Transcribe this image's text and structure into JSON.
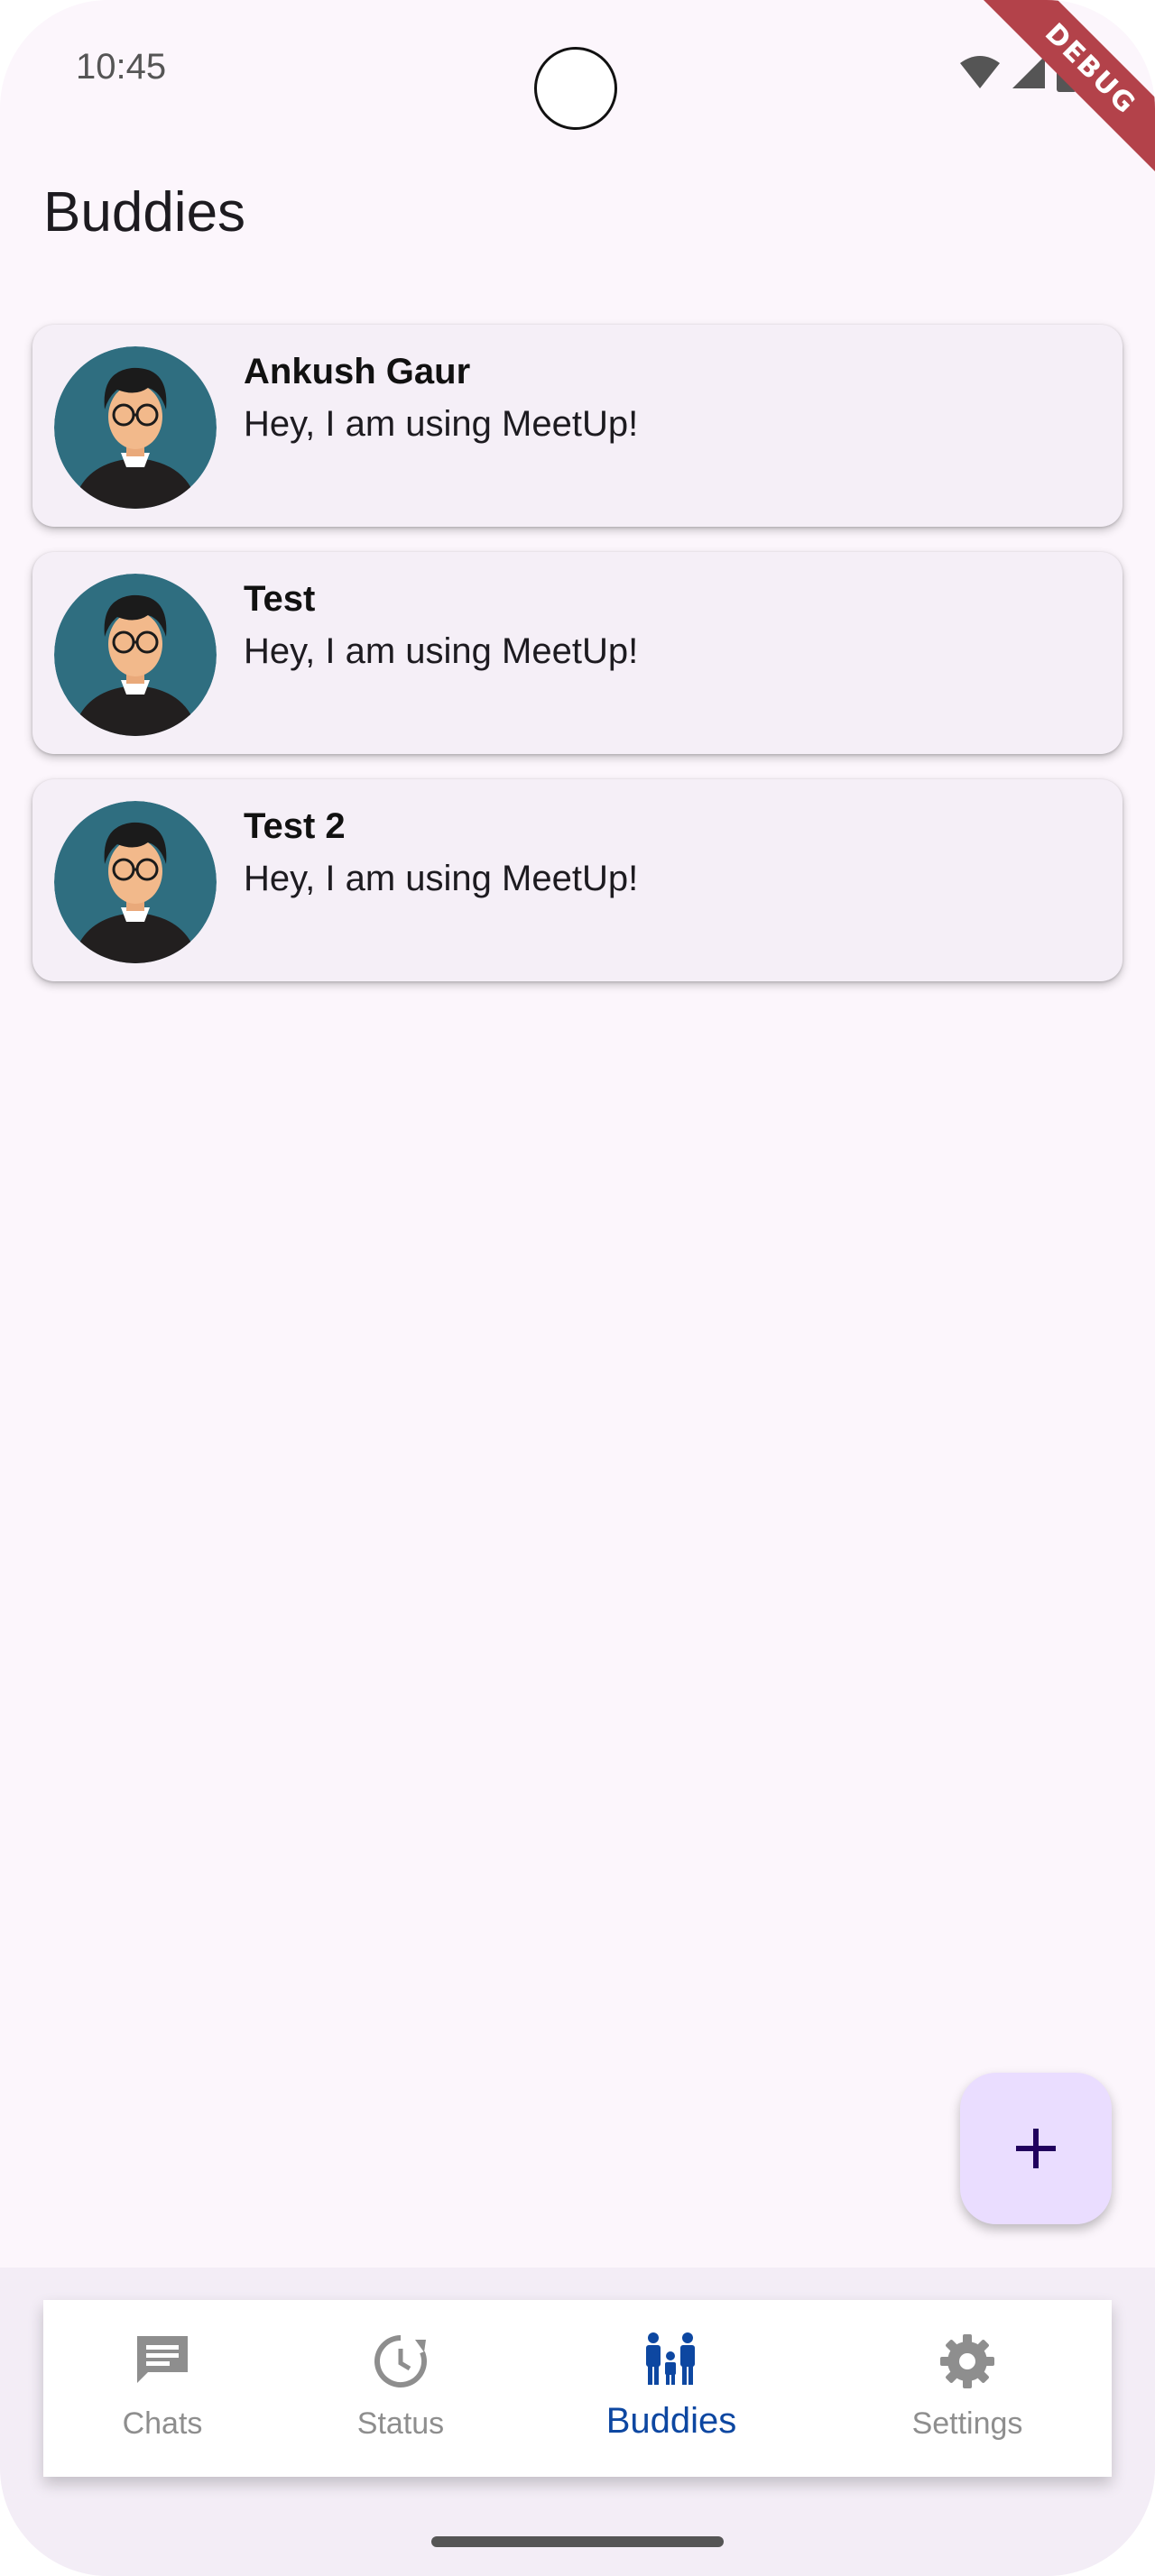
{
  "status_bar": {
    "time": "10:45",
    "debug_label": "DEBUG"
  },
  "app_bar": {
    "title": "Buddies"
  },
  "buddies": [
    {
      "name": "Ankush Gaur",
      "status": "Hey, I am using MeetUp!"
    },
    {
      "name": "Test",
      "status": "Hey, I am using MeetUp!"
    },
    {
      "name": "Test 2",
      "status": "Hey, I am using MeetUp!"
    }
  ],
  "fab": {
    "icon": "add-icon"
  },
  "bottom_nav": {
    "items": [
      {
        "label": "Chats",
        "icon": "chat-icon",
        "active": false
      },
      {
        "label": "Status",
        "icon": "status-icon",
        "active": false
      },
      {
        "label": "Buddies",
        "icon": "people-icon",
        "active": true
      },
      {
        "label": "Settings",
        "icon": "gear-icon",
        "active": false
      }
    ],
    "active_color": "#0d47a1",
    "inactive_color": "#8e8e8e"
  },
  "colors": {
    "background": "#fcf6fc",
    "card": "#f5eff7",
    "fab": "#eaddff",
    "avatar_bg": "#2f6e80",
    "debug_ribbon": "#b3424a"
  }
}
